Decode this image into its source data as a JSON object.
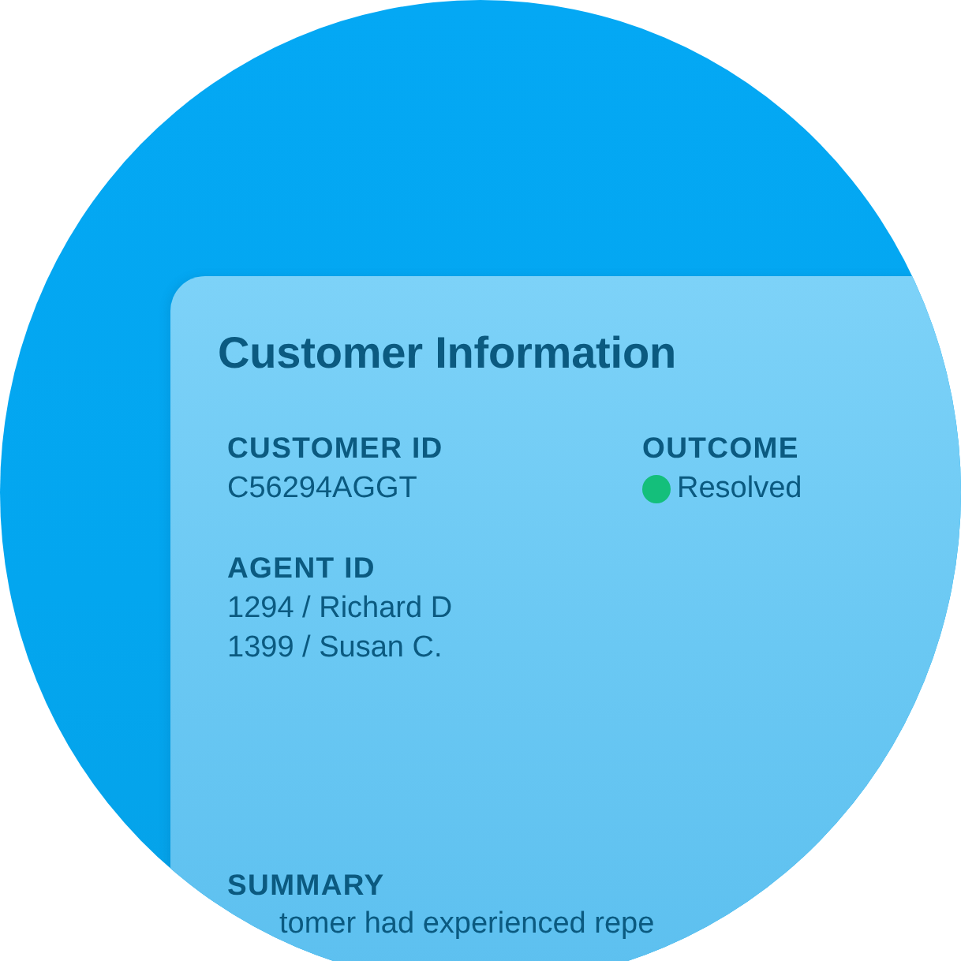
{
  "card": {
    "title": "Customer Information",
    "fields": [
      {
        "kind": "text",
        "label": "CUSTOMER ID",
        "values": [
          "C56294AGGT"
        ]
      },
      {
        "kind": "status",
        "label": "OUTCOME",
        "status": {
          "text": "Resolved",
          "color": "#14bf7b"
        }
      },
      {
        "kind": "text",
        "label": "AGENT ID",
        "values": [
          "1294 / Richard D",
          "1399 / Susan C."
        ]
      }
    ],
    "summary": {
      "label": "SUMMARY",
      "text": "tomer had experienced repe"
    }
  }
}
